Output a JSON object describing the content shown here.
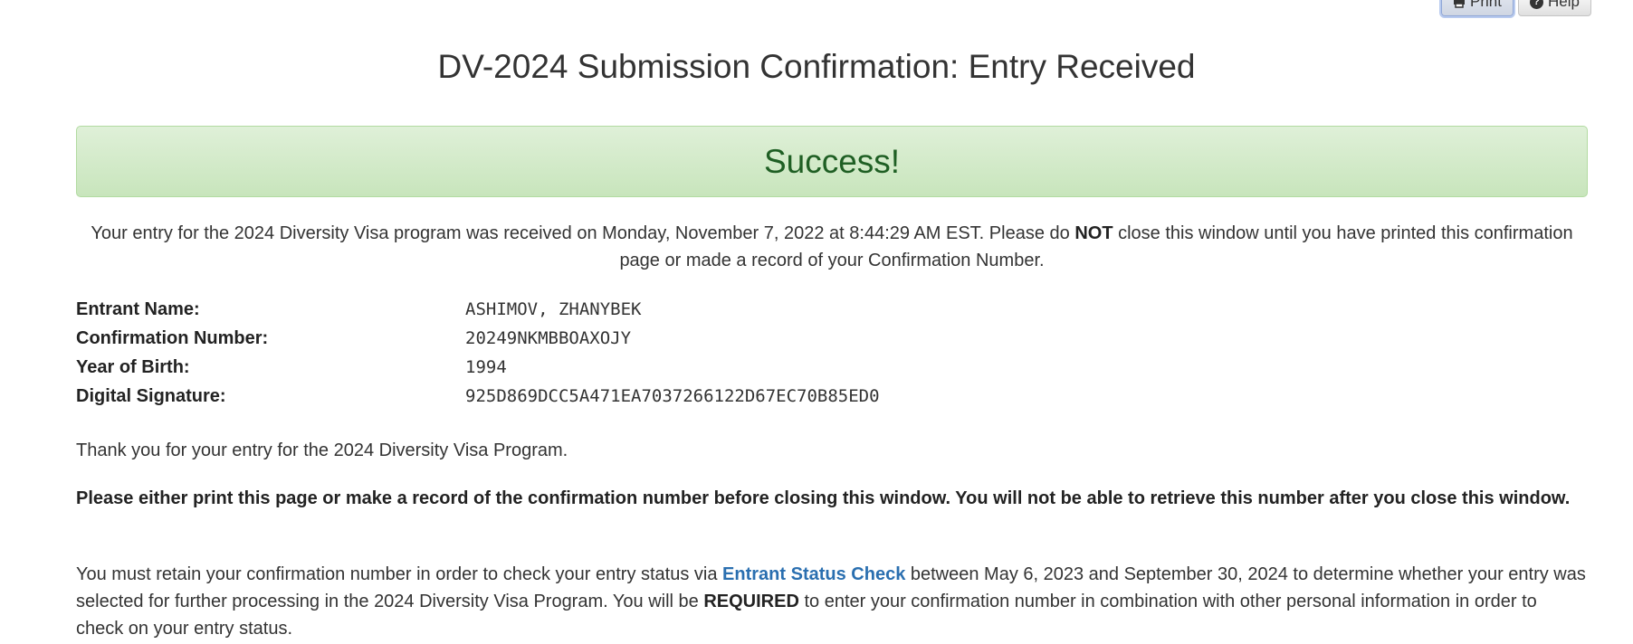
{
  "toolbar": {
    "print_label": "Print",
    "print_icon": "printer-icon",
    "help_label": "Help",
    "help_icon": "question-circle-icon"
  },
  "page_title": "DV-2024 Submission Confirmation: Entry Received",
  "success_banner": {
    "text": "Success!",
    "color": "#1f5f24",
    "background": "#dff0d8"
  },
  "intro": {
    "part1": "Your entry for the 2024 Diversity Visa program was received on Monday, November 7, 2022 at 8:44:29 AM EST. Please do ",
    "emphasis": "NOT",
    "part2": " close this window until you have printed this confirmation page or made a record of your Confirmation Number."
  },
  "details": [
    {
      "label": "Entrant Name:",
      "value": "ASHIMOV, ZHANYBEK"
    },
    {
      "label": "Confirmation Number:",
      "value": "20249NKMBBOAXOJY"
    },
    {
      "label": "Year of Birth:",
      "value": "1994"
    },
    {
      "label": "Digital Signature:",
      "value": "925D869DCC5A471EA7037266122D67EC70B85ED0"
    }
  ],
  "thank_you": "Thank you for your entry for the 2024 Diversity Visa Program.",
  "warning": "Please either print this page or make a record of the confirmation number before closing this window. You will not be able to retrieve this number after you close this window.",
  "retain": {
    "part1": "You must retain your confirmation number in order to check your entry status via ",
    "link_text": "Entrant Status Check",
    "part2": " between May 6, 2023 and September 30, 2024 to determine whether your entry was selected for further processing in the 2024 Diversity Visa Program. You will be ",
    "emphasis": "REQUIRED",
    "part3": " to enter your confirmation number in combination with other personal information in order to check on your entry status.",
    "link_color": "#2a6fb0"
  }
}
